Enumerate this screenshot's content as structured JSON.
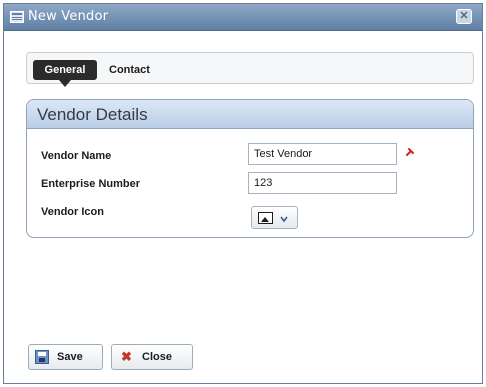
{
  "window": {
    "title": "New Vendor",
    "close_glyph": "✕"
  },
  "tabs": [
    {
      "label": "General",
      "selected": true
    },
    {
      "label": "Contact",
      "selected": false
    }
  ],
  "panel": {
    "title": "Vendor Details",
    "fields": {
      "vendor_name": {
        "label": "Vendor Name",
        "value": "Test Vendor",
        "required": true
      },
      "enterprise_number": {
        "label": "Enterprise Number",
        "value": "123"
      },
      "vendor_icon": {
        "label": "Vendor Icon"
      }
    }
  },
  "buttons": {
    "save": "Save",
    "close": "Close",
    "close_glyph": "✖"
  },
  "colors": {
    "titlebar": "#6f8db1",
    "selected_tab": "#2b2b2b",
    "panel_header": "#c8d9ee",
    "required": "#cc2222"
  },
  "icons": [
    "window-icon",
    "close-icon",
    "required-icon",
    "picture-icon",
    "chevron-down-icon",
    "save-icon",
    "close-x-icon"
  ]
}
